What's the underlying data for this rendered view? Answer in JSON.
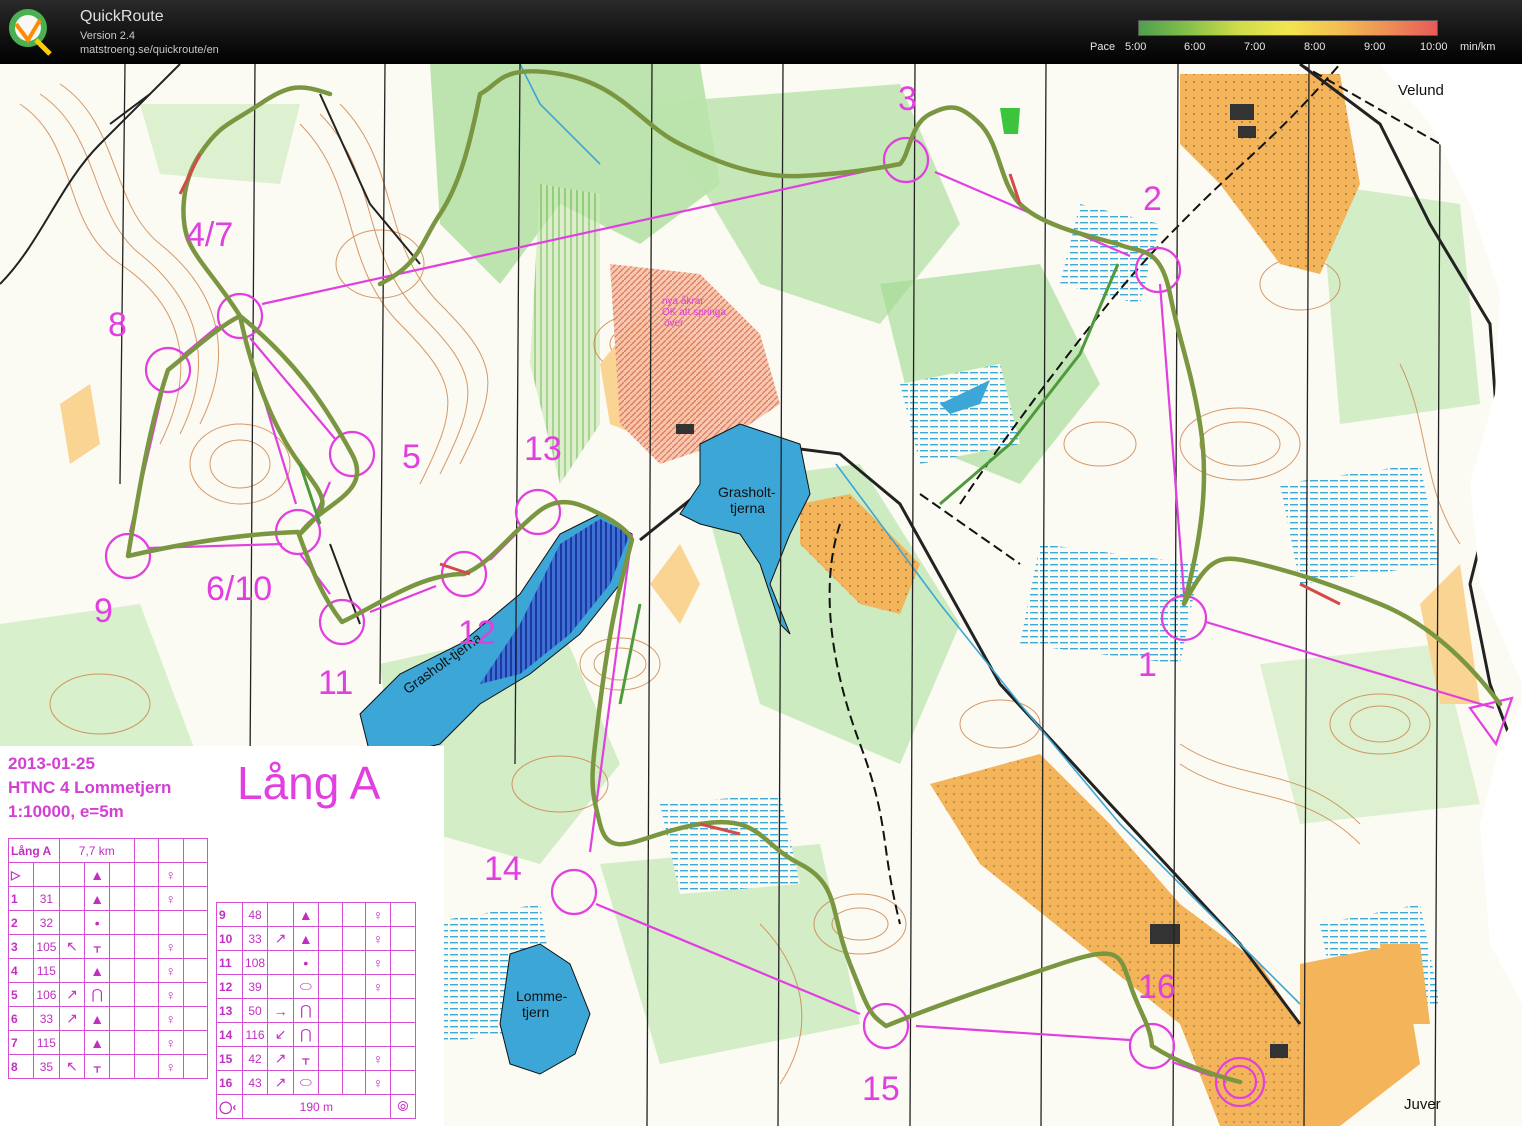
{
  "app": {
    "title": "QuickRoute",
    "version": "Version 2.4",
    "url": "matstroeng.se/quickroute/en"
  },
  "pace_legend": {
    "label": "Pace",
    "ticks": [
      "5:00",
      "6:00",
      "7:00",
      "8:00",
      "9:00",
      "10:00"
    ],
    "unit": "min/km"
  },
  "map_labels": {
    "velund": "Velund",
    "juver": "Juver",
    "lake_grasholt_1": "Grasholt-",
    "lake_grasholt_2": "tjerna",
    "lake_grasholt_west": "Grasholt-tjerna",
    "lake_lomme_1": "Lomme-",
    "lake_lomme_2": "tjern",
    "field_note_1": "nya åkrar",
    "field_note_2": "OK att springa",
    "field_note_3": "över"
  },
  "controls": [
    {
      "label": "1"
    },
    {
      "label": "2"
    },
    {
      "label": "3"
    },
    {
      "label": "4/7"
    },
    {
      "label": "5"
    },
    {
      "label": "6/10"
    },
    {
      "label": "8"
    },
    {
      "label": "9"
    },
    {
      "label": "11"
    },
    {
      "label": "12"
    },
    {
      "label": "13"
    },
    {
      "label": "14"
    },
    {
      "label": "15"
    },
    {
      "label": "16"
    }
  ],
  "event": {
    "date": "2013-01-25",
    "name": "HTNC 4 Lommetjern",
    "scale": "1:10000, e=5m",
    "course_title": "Lång A"
  },
  "description_table": {
    "course": "Lång A",
    "length": "7,7 km",
    "start_symbol": "▷",
    "left_rows": [
      {
        "num": "1",
        "code": "31",
        "dir": "",
        "feature": "▲",
        "pos": "♀"
      },
      {
        "num": "2",
        "code": "32",
        "dir": "",
        "feature": "•",
        "pos": ""
      },
      {
        "num": "3",
        "code": "105",
        "dir": "↖",
        "feature": "ᚁ",
        "pos": "♀"
      },
      {
        "num": "4",
        "code": "115",
        "dir": "",
        "feature": "▲",
        "pos": "♀"
      },
      {
        "num": "5",
        "code": "106",
        "dir": "↗",
        "feature": "⋂",
        "pos": "♀"
      },
      {
        "num": "6",
        "code": "33",
        "dir": "↗",
        "feature": "▲",
        "pos": "♀"
      },
      {
        "num": "7",
        "code": "115",
        "dir": "",
        "feature": "▲",
        "pos": "♀"
      },
      {
        "num": "8",
        "code": "35",
        "dir": "↖",
        "feature": "ᚁ",
        "pos": "♀"
      }
    ],
    "right_rows": [
      {
        "num": "9",
        "code": "48",
        "dir": "",
        "feature": "▲",
        "pos": "♀"
      },
      {
        "num": "10",
        "code": "33",
        "dir": "↗",
        "feature": "▲",
        "pos": "♀"
      },
      {
        "num": "11",
        "code": "108",
        "dir": "",
        "feature": "•",
        "pos": "♀"
      },
      {
        "num": "12",
        "code": "39",
        "dir": "",
        "feature": "⬭",
        "pos": "♀"
      },
      {
        "num": "13",
        "code": "50",
        "dir": "→",
        "feature": "⋂",
        "pos": ""
      },
      {
        "num": "14",
        "code": "116",
        "dir": "↙",
        "feature": "⋂",
        "pos": ""
      },
      {
        "num": "15",
        "code": "42",
        "dir": "↗",
        "feature": "ᚁ",
        "pos": "♀"
      },
      {
        "num": "16",
        "code": "43",
        "dir": "↗",
        "feature": "⬭",
        "pos": "♀"
      }
    ],
    "finish_distance": "190 m"
  },
  "colors": {
    "course_magenta": "#e13fe0",
    "route_green": "#6b8f3a",
    "water_blue": "#3ca6d6",
    "field_orange": "#f4b45a",
    "forest_green": "#9ed88f",
    "contour_brown": "#b5652a"
  }
}
